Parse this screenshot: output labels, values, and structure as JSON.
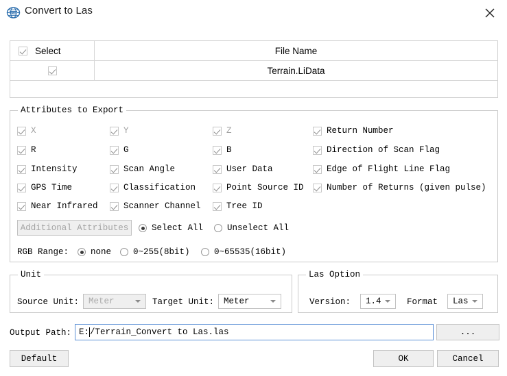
{
  "window": {
    "title": "Convert to Las",
    "icon": "lidar-globe-icon",
    "close_label": "close-icon",
    "accent_color": "#5a8fd6"
  },
  "file_table": {
    "columns": [
      "Select",
      "File Name"
    ],
    "header_checkbox": true,
    "rows": [
      {
        "selected": true,
        "file_name": "Terrain.LiData"
      }
    ]
  },
  "attributes_group": {
    "legend": "Attributes to Export",
    "items": [
      {
        "label": "X",
        "checked": true,
        "disabled": true,
        "col": 0,
        "row": 0
      },
      {
        "label": "Y",
        "checked": true,
        "disabled": true,
        "col": 1,
        "row": 0
      },
      {
        "label": "Z",
        "checked": true,
        "disabled": true,
        "col": 2,
        "row": 0
      },
      {
        "label": "Return Number",
        "checked": true,
        "disabled": false,
        "col": 3,
        "row": 0
      },
      {
        "label": "R",
        "checked": true,
        "disabled": false,
        "col": 0,
        "row": 1
      },
      {
        "label": "G",
        "checked": true,
        "disabled": false,
        "col": 1,
        "row": 1
      },
      {
        "label": "B",
        "checked": true,
        "disabled": false,
        "col": 2,
        "row": 1
      },
      {
        "label": "Direction of Scan Flag",
        "checked": true,
        "disabled": false,
        "col": 3,
        "row": 1
      },
      {
        "label": "Intensity",
        "checked": true,
        "disabled": false,
        "col": 0,
        "row": 2
      },
      {
        "label": "Scan Angle",
        "checked": true,
        "disabled": false,
        "col": 1,
        "row": 2
      },
      {
        "label": "User Data",
        "checked": true,
        "disabled": false,
        "col": 2,
        "row": 2
      },
      {
        "label": "Edge of Flight Line Flag",
        "checked": true,
        "disabled": false,
        "col": 3,
        "row": 2
      },
      {
        "label": "GPS Time",
        "checked": true,
        "disabled": false,
        "col": 0,
        "row": 3
      },
      {
        "label": "Classification",
        "checked": true,
        "disabled": false,
        "col": 1,
        "row": 3
      },
      {
        "label": "Point Source ID",
        "checked": true,
        "disabled": false,
        "col": 2,
        "row": 3
      },
      {
        "label": "Number of Returns (given pulse)",
        "checked": true,
        "disabled": false,
        "col": 3,
        "row": 3
      },
      {
        "label": "Near Infrared",
        "checked": true,
        "disabled": false,
        "col": 0,
        "row": 4
      },
      {
        "label": "Scanner Channel",
        "checked": true,
        "disabled": false,
        "col": 1,
        "row": 4
      },
      {
        "label": "Tree ID",
        "checked": true,
        "disabled": false,
        "col": 2,
        "row": 4
      }
    ],
    "additional_attributes_button": "Additional Attributes",
    "additional_attributes_disabled": true,
    "selection_radios": [
      {
        "label": "Select All",
        "checked": true
      },
      {
        "label": "Unselect All",
        "checked": false
      }
    ],
    "rgb_range_label": "RGB Range:",
    "rgb_range_radios": [
      {
        "label": "none",
        "checked": true
      },
      {
        "label": "0~255(8bit)",
        "checked": false
      },
      {
        "label": "0~65535(16bit)",
        "checked": false
      }
    ]
  },
  "unit_group": {
    "legend": "Unit",
    "source_unit_label": "Source Unit:",
    "source_unit_value": "Meter",
    "source_unit_disabled": true,
    "target_unit_label": "Target Unit:",
    "target_unit_value": "Meter",
    "target_unit_disabled": false
  },
  "las_option_group": {
    "legend": "Las Option",
    "version_label": "Version:",
    "version_value": "1.4",
    "format_label": "Format",
    "format_value": "Las"
  },
  "output": {
    "label": "Output Path:",
    "value_before_caret": "E:",
    "value_after_caret": "/Terrain_Convert to Las.las",
    "full_value": "E:/Terrain_Convert to Las.las",
    "browse_label": "..."
  },
  "footer": {
    "default_label": "Default",
    "ok_label": "OK",
    "cancel_label": "Cancel"
  }
}
